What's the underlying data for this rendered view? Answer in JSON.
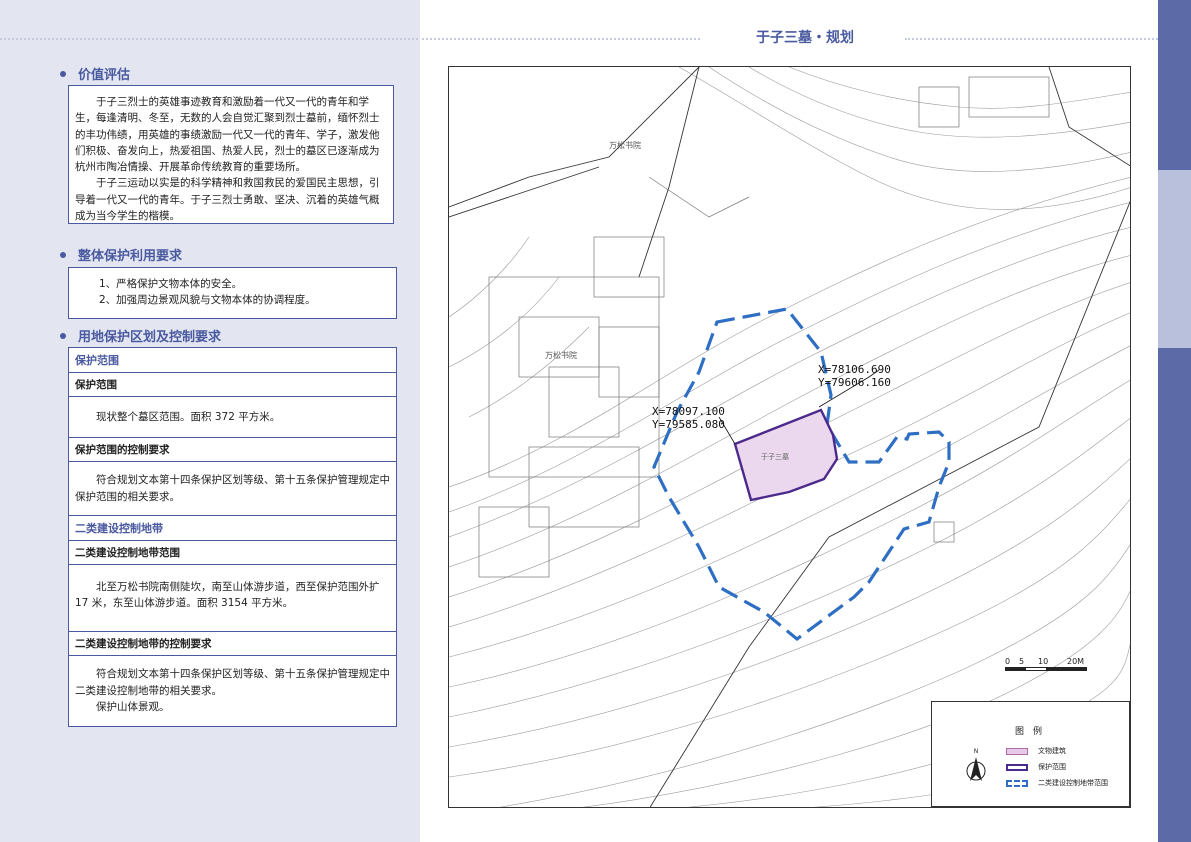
{
  "page_title": "于子三墓・规划",
  "sections": {
    "value": {
      "title": "价值评估",
      "paragraphs": [
        "于子三烈士的英雄事迹教育和激励着一代又一代的青年和学生，每逢清明、冬至，无数的人会自觉汇聚到烈士墓前，缅怀烈士的丰功伟绩，用英雄的事绩激励一代又一代的青年、学子，激发他们积极、奋发向上，热爱祖国、热爱人民，烈士的墓区已逐渐成为杭州市陶冶情操、开展革命传统教育的重要场所。",
        "于子三运动以实是的科学精神和救国救民的爱国民主思想，引导着一代又一代的青年。于子三烈士勇敢、坚决、沉着的英雄气概成为当今学生的楷模。"
      ]
    },
    "overall": {
      "title": "整体保护利用要求",
      "items": [
        "1、严格保护文物本体的安全。",
        "2、加强周边景观风貌与文物本体的协调程度。"
      ]
    },
    "landuse": {
      "title": "用地保护区划及控制要求",
      "protect_range": "保护范围",
      "protect_range_sub": "保护范围",
      "protect_range_text": "现状整个墓区范围。面积 372 平方米。",
      "protect_control_title": "保护范围的控制要求",
      "protect_control_text": "符合规划文本第十四条保护区划等级、第十五条保护管理规定中保护范围的相关要求。",
      "zone2": "二类建设控制地带",
      "zone2_range_title": "二类建设控制地带范围",
      "zone2_range_text": "北至万松书院南侧陡坎，南至山体游步道，西至保护范围外扩 17 米，东至山体游步道。面积 3154 平方米。",
      "zone2_control_title": "二类建设控制地带的控制要求",
      "zone2_control_text": "符合规划文本第十四条保护区划等级、第十五条保护管理规定中二类建设控制地带的相关要求。",
      "zone2_control_text2": "保护山体景观。"
    }
  },
  "map": {
    "coord1": [
      "X=78106.690",
      "Y=79606.160"
    ],
    "coord2": [
      "X=78097.100",
      "Y=79585.080"
    ],
    "place_wansong": "万松书院",
    "place_wansong2": "万松书院",
    "tomb_label": "于子三墓",
    "scale_labels": [
      "0",
      "5",
      "10",
      "20M"
    ],
    "north": "N"
  },
  "legend": {
    "title": "图　例",
    "items": [
      "文物建筑",
      "保护范围",
      "二类建设控制地带范围"
    ],
    "colors": {
      "building": "#d9a6d6",
      "protect": "#4b2a8c",
      "zone2": "#2e6fc4"
    }
  }
}
